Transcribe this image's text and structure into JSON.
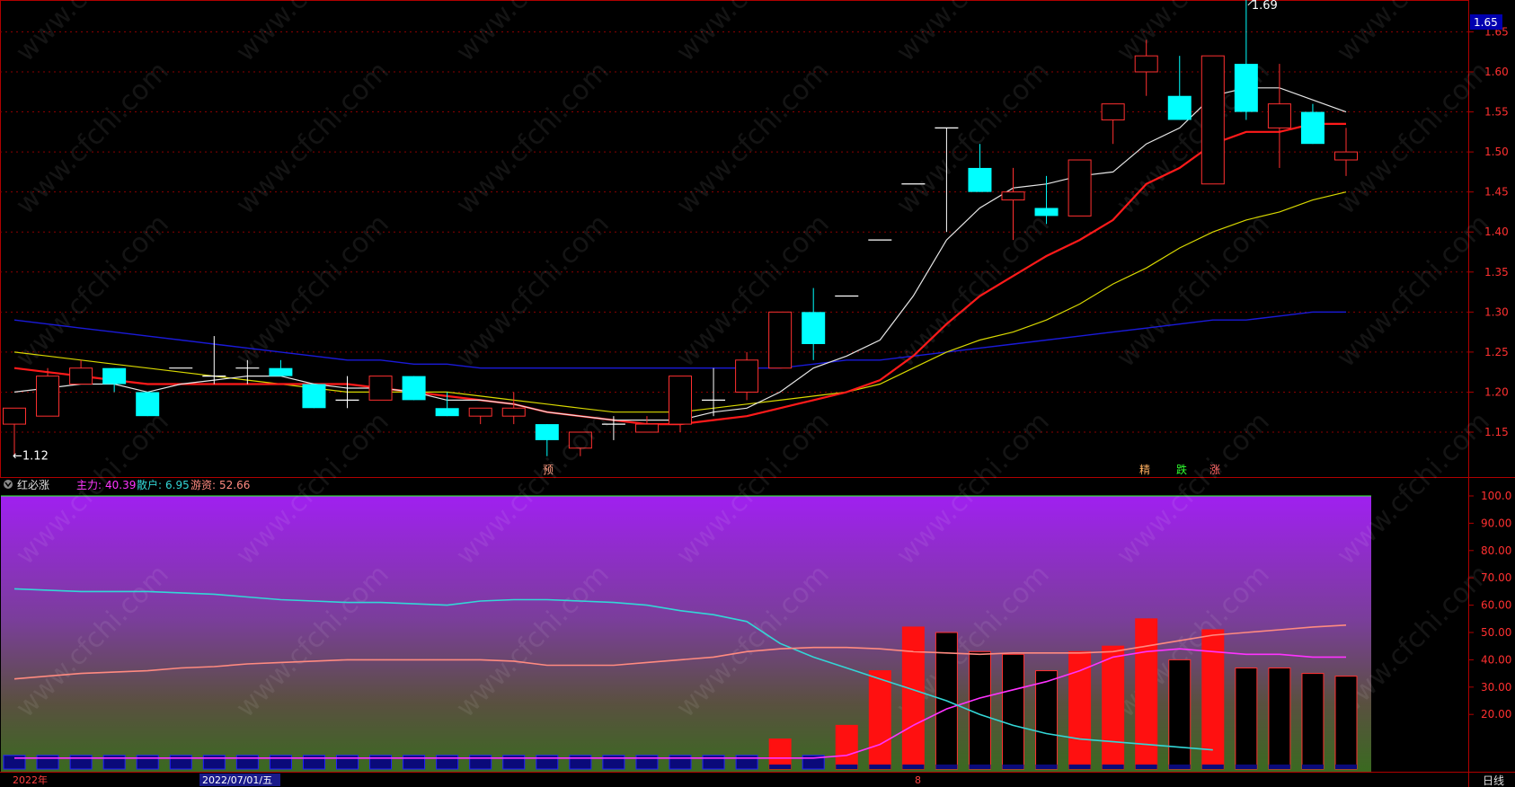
{
  "colors": {
    "bg": "#000000",
    "grid": "#8a0000",
    "axis": "#b00000",
    "up": "#ff3030",
    "down": "#00ffff",
    "ma_white": "#e6e6e6",
    "ma_red": "#ff1a1a",
    "ma_yellow": "#d8d800",
    "ma_blue": "#1a1ad8",
    "main_force": "#ff33ff",
    "retail": "#33d6d6",
    "hot_money": "#ff8a80",
    "price_label_bg": "#0000b0"
  },
  "price_axis": {
    "ticks": [
      "1.65",
      "1.60",
      "1.55",
      "1.50",
      "1.45",
      "1.40",
      "1.35",
      "1.30",
      "1.25",
      "1.20",
      "1.15"
    ],
    "current_price": "1.65"
  },
  "annotations": {
    "high_label": "1.69",
    "low_label": "←1.12",
    "signal_yu": "预",
    "signal_jing": "精",
    "signal_die": "跌",
    "signal_zhang": "涨"
  },
  "indicator": {
    "name": "红必涨",
    "main_force_label": "主力:",
    "main_force_value": "40.39",
    "retail_label": "散户:",
    "retail_value": "6.95",
    "hot_money_label": "游资:",
    "hot_money_value": "52.66",
    "axis_ticks": [
      "100.0",
      "90.00",
      "80.00",
      "70.00",
      "60.00",
      "50.00",
      "40.00",
      "30.00",
      "20.00"
    ]
  },
  "bottom_bar": {
    "year_label": "2022年",
    "date_label": "2022/07/01/五",
    "marker": "8",
    "period_label": "日线"
  },
  "watermark": "www.cfchi.com",
  "chart_data": [
    {
      "type": "candlestick",
      "title": "",
      "ylim": [
        1.12,
        1.7
      ],
      "candles": [
        {
          "o": 1.16,
          "h": 1.18,
          "l": 1.12,
          "c": 1.18
        },
        {
          "o": 1.17,
          "h": 1.23,
          "l": 1.17,
          "c": 1.22
        },
        {
          "o": 1.21,
          "h": 1.24,
          "l": 1.21,
          "c": 1.23
        },
        {
          "o": 1.23,
          "h": 1.23,
          "l": 1.2,
          "c": 1.21
        },
        {
          "o": 1.2,
          "h": 1.2,
          "l": 1.17,
          "c": 1.17
        },
        {
          "o": 1.23,
          "h": 1.23,
          "l": 1.23,
          "c": 1.23
        },
        {
          "o": 1.22,
          "h": 1.27,
          "l": 1.21,
          "c": 1.22
        },
        {
          "o": 1.23,
          "h": 1.24,
          "l": 1.21,
          "c": 1.23
        },
        {
          "o": 1.23,
          "h": 1.24,
          "l": 1.22,
          "c": 1.22
        },
        {
          "o": 1.21,
          "h": 1.21,
          "l": 1.18,
          "c": 1.18
        },
        {
          "o": 1.19,
          "h": 1.22,
          "l": 1.18,
          "c": 1.19
        },
        {
          "o": 1.19,
          "h": 1.22,
          "l": 1.19,
          "c": 1.22
        },
        {
          "o": 1.22,
          "h": 1.22,
          "l": 1.19,
          "c": 1.19
        },
        {
          "o": 1.18,
          "h": 1.2,
          "l": 1.17,
          "c": 1.17
        },
        {
          "o": 1.17,
          "h": 1.18,
          "l": 1.16,
          "c": 1.18
        },
        {
          "o": 1.17,
          "h": 1.2,
          "l": 1.16,
          "c": 1.18
        },
        {
          "o": 1.16,
          "h": 1.16,
          "l": 1.12,
          "c": 1.14
        },
        {
          "o": 1.13,
          "h": 1.15,
          "l": 1.12,
          "c": 1.15
        },
        {
          "o": 1.16,
          "h": 1.17,
          "l": 1.14,
          "c": 1.16
        },
        {
          "o": 1.15,
          "h": 1.17,
          "l": 1.15,
          "c": 1.16
        },
        {
          "o": 1.16,
          "h": 1.22,
          "l": 1.15,
          "c": 1.22
        },
        {
          "o": 1.19,
          "h": 1.23,
          "l": 1.17,
          "c": 1.19
        },
        {
          "o": 1.2,
          "h": 1.25,
          "l": 1.19,
          "c": 1.24
        },
        {
          "o": 1.23,
          "h": 1.3,
          "l": 1.23,
          "c": 1.3
        },
        {
          "o": 1.3,
          "h": 1.33,
          "l": 1.24,
          "c": 1.26
        },
        {
          "o": 1.32,
          "h": 1.32,
          "l": 1.32,
          "c": 1.32
        },
        {
          "o": 1.39,
          "h": 1.39,
          "l": 1.39,
          "c": 1.39
        },
        {
          "o": 1.46,
          "h": 1.46,
          "l": 1.46,
          "c": 1.46
        },
        {
          "o": 1.53,
          "h": 1.53,
          "l": 1.4,
          "c": 1.53
        },
        {
          "o": 1.48,
          "h": 1.51,
          "l": 1.45,
          "c": 1.45
        },
        {
          "o": 1.44,
          "h": 1.48,
          "l": 1.39,
          "c": 1.45
        },
        {
          "o": 1.43,
          "h": 1.47,
          "l": 1.41,
          "c": 1.42
        },
        {
          "o": 1.42,
          "h": 1.49,
          "l": 1.42,
          "c": 1.49
        },
        {
          "o": 1.54,
          "h": 1.56,
          "l": 1.51,
          "c": 1.56
        },
        {
          "o": 1.6,
          "h": 1.64,
          "l": 1.57,
          "c": 1.62
        },
        {
          "o": 1.57,
          "h": 1.62,
          "l": 1.54,
          "c": 1.54
        },
        {
          "o": 1.46,
          "h": 1.62,
          "l": 1.46,
          "c": 1.62
        },
        {
          "o": 1.61,
          "h": 1.69,
          "l": 1.54,
          "c": 1.55
        },
        {
          "o": 1.53,
          "h": 1.61,
          "l": 1.48,
          "c": 1.56
        },
        {
          "o": 1.55,
          "h": 1.56,
          "l": 1.51,
          "c": 1.51
        },
        {
          "o": 1.49,
          "h": 1.53,
          "l": 1.47,
          "c": 1.5
        }
      ],
      "ma_white": [
        1.2,
        1.205,
        1.21,
        1.21,
        1.2,
        1.21,
        1.215,
        1.22,
        1.22,
        1.21,
        1.205,
        1.205,
        1.2,
        1.19,
        1.19,
        1.185,
        1.175,
        1.17,
        1.165,
        1.165,
        1.165,
        1.175,
        1.18,
        1.2,
        1.23,
        1.245,
        1.265,
        1.32,
        1.39,
        1.43,
        1.455,
        1.46,
        1.47,
        1.475,
        1.51,
        1.53,
        1.57,
        1.58,
        1.58,
        1.565,
        1.55
      ],
      "ma_red": [
        1.23,
        1.225,
        1.22,
        1.215,
        1.21,
        1.21,
        1.21,
        1.21,
        1.21,
        1.21,
        1.21,
        1.205,
        1.2,
        1.195,
        1.19,
        1.185,
        1.175,
        1.17,
        1.165,
        1.16,
        1.16,
        1.165,
        1.17,
        1.18,
        1.19,
        1.2,
        1.215,
        1.245,
        1.285,
        1.32,
        1.345,
        1.37,
        1.39,
        1.415,
        1.46,
        1.48,
        1.51,
        1.525,
        1.525,
        1.535,
        1.535
      ],
      "ma_yellow": [
        1.25,
        1.245,
        1.24,
        1.235,
        1.23,
        1.225,
        1.22,
        1.215,
        1.21,
        1.205,
        1.2,
        1.2,
        1.2,
        1.2,
        1.195,
        1.19,
        1.185,
        1.18,
        1.175,
        1.175,
        1.175,
        1.18,
        1.185,
        1.19,
        1.195,
        1.2,
        1.21,
        1.23,
        1.25,
        1.265,
        1.275,
        1.29,
        1.31,
        1.335,
        1.355,
        1.38,
        1.4,
        1.415,
        1.425,
        1.44,
        1.45
      ],
      "ma_blue": [
        1.29,
        1.285,
        1.28,
        1.275,
        1.27,
        1.265,
        1.26,
        1.255,
        1.25,
        1.245,
        1.24,
        1.24,
        1.235,
        1.235,
        1.23,
        1.23,
        1.23,
        1.23,
        1.23,
        1.23,
        1.23,
        1.23,
        1.23,
        1.23,
        1.235,
        1.24,
        1.24,
        1.245,
        1.25,
        1.255,
        1.26,
        1.265,
        1.27,
        1.275,
        1.28,
        1.285,
        1.29,
        1.29,
        1.295,
        1.3,
        1.3
      ]
    },
    {
      "type": "bar+line",
      "title": "红必涨",
      "ylim": [
        0,
        100
      ],
      "bars": [
        5,
        5,
        5,
        5,
        5,
        5,
        5,
        5,
        5,
        5,
        5,
        5,
        5,
        5,
        5,
        5,
        5,
        5,
        5,
        5,
        5,
        5,
        5,
        11,
        5,
        16,
        36,
        52,
        50,
        43,
        42,
        36,
        43,
        45,
        55,
        40,
        51,
        37,
        37,
        35,
        34
      ],
      "bar_colors": [
        "blue",
        "blue",
        "blue",
        "blue",
        "blue",
        "blue",
        "blue",
        "blue",
        "blue",
        "blue",
        "blue",
        "blue",
        "blue",
        "blue",
        "blue",
        "blue",
        "blue",
        "blue",
        "blue",
        "blue",
        "blue",
        "blue",
        "blue",
        "red",
        "blue",
        "red",
        "red",
        "red",
        "black",
        "black",
        "black",
        "black",
        "red",
        "red",
        "red",
        "black",
        "red",
        "black",
        "black",
        "black",
        "black"
      ],
      "series": [
        {
          "name": "主力",
          "values": [
            4,
            4,
            4,
            4,
            4,
            4,
            4,
            4,
            4,
            4,
            4,
            4,
            4,
            4,
            4,
            4,
            4,
            4,
            4,
            4,
            4,
            4,
            4,
            4,
            4,
            5,
            9,
            16,
            22,
            26,
            29,
            32,
            36,
            41,
            43,
            44,
            43,
            42,
            42,
            41,
            41
          ]
        },
        {
          "name": "散户",
          "values": [
            66,
            65.5,
            65,
            65,
            65,
            64.5,
            64,
            63,
            62,
            61.5,
            61,
            61,
            60.5,
            60,
            61.5,
            62,
            62,
            61.5,
            61,
            60,
            58,
            56.5,
            54,
            46,
            41,
            37,
            33,
            29,
            25,
            20,
            16,
            13,
            11,
            10,
            9,
            8,
            7
          ]
        },
        {
          "name": "游资",
          "values": [
            33,
            34,
            35,
            35.5,
            36,
            37,
            37.5,
            38.5,
            39,
            39.5,
            40,
            40,
            40,
            40,
            40,
            39.5,
            38,
            38,
            38,
            39,
            40,
            41,
            43,
            44,
            44.5,
            44.5,
            44,
            43,
            42.5,
            42,
            42.5,
            42.5,
            42.5,
            43,
            45,
            47,
            49,
            50,
            51,
            52,
            52.7
          ]
        }
      ]
    }
  ]
}
